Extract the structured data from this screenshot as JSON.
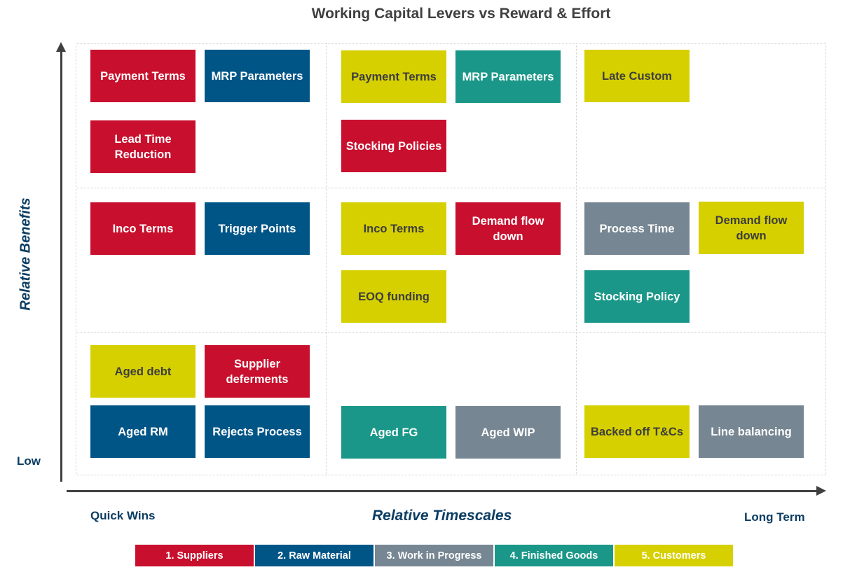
{
  "title": "Working Capital Levers vs Reward & Effort",
  "axes": {
    "y_label": "Relative Benefits",
    "y_low_label": "Low",
    "x_label": "Relative Timescales",
    "x_start_label": "Quick Wins",
    "x_end_label": "Long Term"
  },
  "categories": [
    {
      "id": 1,
      "label": "1. Suppliers",
      "color": "#C8102E"
    },
    {
      "id": 2,
      "label": "2. Raw Material",
      "color": "#005587"
    },
    {
      "id": 3,
      "label": "3. Work in Progress",
      "color": "#768692"
    },
    {
      "id": 4,
      "label": "4. Finished Goods",
      "color": "#1A9788"
    },
    {
      "id": 5,
      "label": "5. Customers",
      "color": "#D6D000"
    }
  ],
  "matrix": {
    "rows": [
      "high",
      "medium",
      "low"
    ],
    "columns": [
      "quick-wins",
      "medium-term",
      "long-term"
    ],
    "levers": [
      {
        "label": "Payment Terms",
        "category": 1,
        "row": "high",
        "column": "quick-wins"
      },
      {
        "label": "MRP Parameters",
        "category": 2,
        "row": "high",
        "column": "quick-wins"
      },
      {
        "label": "Lead Time Reduction",
        "category": 1,
        "row": "high",
        "column": "quick-wins"
      },
      {
        "label": "Payment Terms",
        "category": 5,
        "row": "high",
        "column": "medium-term"
      },
      {
        "label": "MRP Parameters",
        "category": 4,
        "row": "high",
        "column": "medium-term"
      },
      {
        "label": "Stocking Policies",
        "category": 1,
        "row": "high",
        "column": "medium-term"
      },
      {
        "label": "Late Custom",
        "category": 5,
        "row": "high",
        "column": "long-term"
      },
      {
        "label": "Inco Terms",
        "category": 1,
        "row": "medium",
        "column": "quick-wins"
      },
      {
        "label": "Trigger Points",
        "category": 2,
        "row": "medium",
        "column": "quick-wins"
      },
      {
        "label": "Inco Terms",
        "category": 5,
        "row": "medium",
        "column": "medium-term"
      },
      {
        "label": "Demand flow down",
        "category": 1,
        "row": "medium",
        "column": "medium-term"
      },
      {
        "label": "EOQ funding",
        "category": 5,
        "row": "medium",
        "column": "medium-term"
      },
      {
        "label": "Process Time",
        "category": 3,
        "row": "medium",
        "column": "long-term"
      },
      {
        "label": "Demand flow down",
        "category": 5,
        "row": "medium",
        "column": "long-term"
      },
      {
        "label": "Stocking Policy",
        "category": 4,
        "row": "medium",
        "column": "long-term"
      },
      {
        "label": "Aged debt",
        "category": 5,
        "row": "low",
        "column": "quick-wins"
      },
      {
        "label": "Supplier deferments",
        "category": 1,
        "row": "low",
        "column": "quick-wins"
      },
      {
        "label": "Aged RM",
        "category": 2,
        "row": "low",
        "column": "quick-wins"
      },
      {
        "label": "Rejects Process",
        "category": 2,
        "row": "low",
        "column": "quick-wins"
      },
      {
        "label": "Aged FG",
        "category": 4,
        "row": "low",
        "column": "medium-term"
      },
      {
        "label": "Aged WIP",
        "category": 3,
        "row": "low",
        "column": "medium-term"
      },
      {
        "label": "Backed off T&Cs",
        "category": 5,
        "row": "low",
        "column": "long-term"
      },
      {
        "label": "Line balancing",
        "category": 3,
        "row": "low",
        "column": "long-term"
      }
    ]
  }
}
